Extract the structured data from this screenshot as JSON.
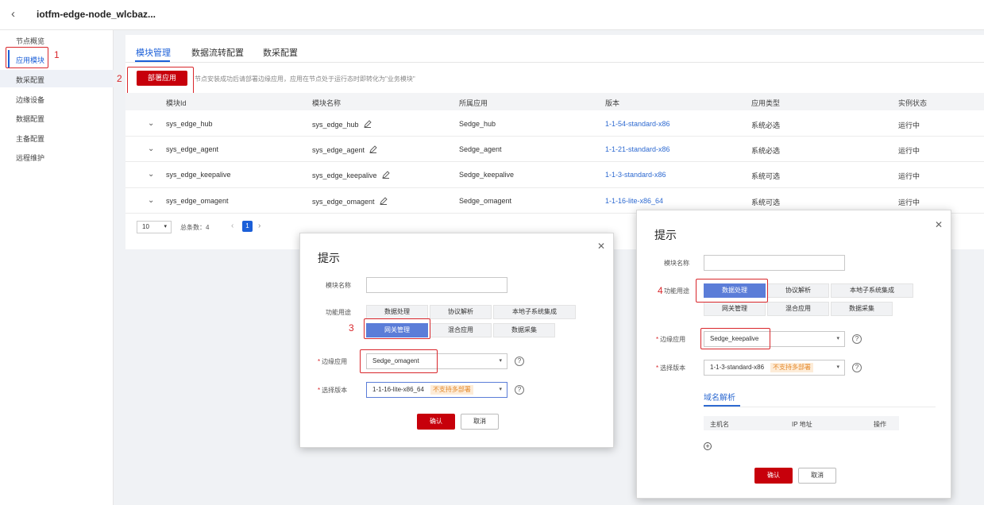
{
  "header": {
    "title": "iotfm-edge-node_wlcbaz..."
  },
  "sidebar": {
    "items": [
      "节点概览",
      "应用模块",
      "数采配置",
      "边缘设备",
      "数据配置",
      "主备配置",
      "远程维护"
    ]
  },
  "tabs": [
    "模块管理",
    "数据流转配置",
    "数采配置"
  ],
  "toolbar": {
    "deploy_label": "部署应用",
    "hint": "节点安装成功后请部署边缘应用，应用在节点处于运行态时即转化为\"业务模块\""
  },
  "table": {
    "columns": [
      "模块Id",
      "模块名称",
      "所属应用",
      "版本",
      "应用类型",
      "实例状态"
    ],
    "rows": [
      [
        "sys_edge_hub",
        "sys_edge_hub",
        "Sedge_hub",
        "1-1-54-standard-x86",
        "系统必选",
        "运行中"
      ],
      [
        "sys_edge_agent",
        "sys_edge_agent",
        "Sedge_agent",
        "1-1-21-standard-x86",
        "系统必选",
        "运行中"
      ],
      [
        "sys_edge_keepalive",
        "sys_edge_keepalive",
        "Sedge_keepalive",
        "1-1-3-standard-x86",
        "系统可选",
        "运行中"
      ],
      [
        "sys_edge_omagent",
        "sys_edge_omagent",
        "Sedge_omagent",
        "1-1-16-lite-x86_64",
        "系统可选",
        "运行中"
      ]
    ]
  },
  "pager": {
    "size": "10",
    "total": "总条数：4",
    "page": "1"
  },
  "annotations": [
    "1",
    "2",
    "3",
    "4"
  ],
  "dialog1": {
    "title": "提示",
    "module_name_label": "模块名称",
    "purpose_label": "功能用途",
    "chips": [
      "数据处理",
      "协议解析",
      "本地子系统集成",
      "网关管理",
      "混合应用",
      "数据采集"
    ],
    "edge_app_label": "边缘应用",
    "edge_app_value": "Sedge_omagent",
    "version_label": "选择版本",
    "version_value": "1-1-16-lite-x86_64",
    "badge": "不支持多部署",
    "ok": "确认",
    "cancel": "取消"
  },
  "dialog2": {
    "title": "提示",
    "module_name_label": "模块名称",
    "purpose_label": "功能用途",
    "chips": [
      "数据处理",
      "协议解析",
      "本地子系统集成",
      "网关管理",
      "混合应用",
      "数据采集"
    ],
    "edge_app_label": "边缘应用",
    "edge_app_value": "Sedge_keepalive",
    "version_label": "选择版本",
    "version_value": "1-1-3-standard-x86",
    "badge": "不支持多部署",
    "subtab": "域名解析",
    "dns_columns": [
      "主机名",
      "IP 地址",
      "操作"
    ],
    "ok": "确认",
    "cancel": "取消"
  }
}
